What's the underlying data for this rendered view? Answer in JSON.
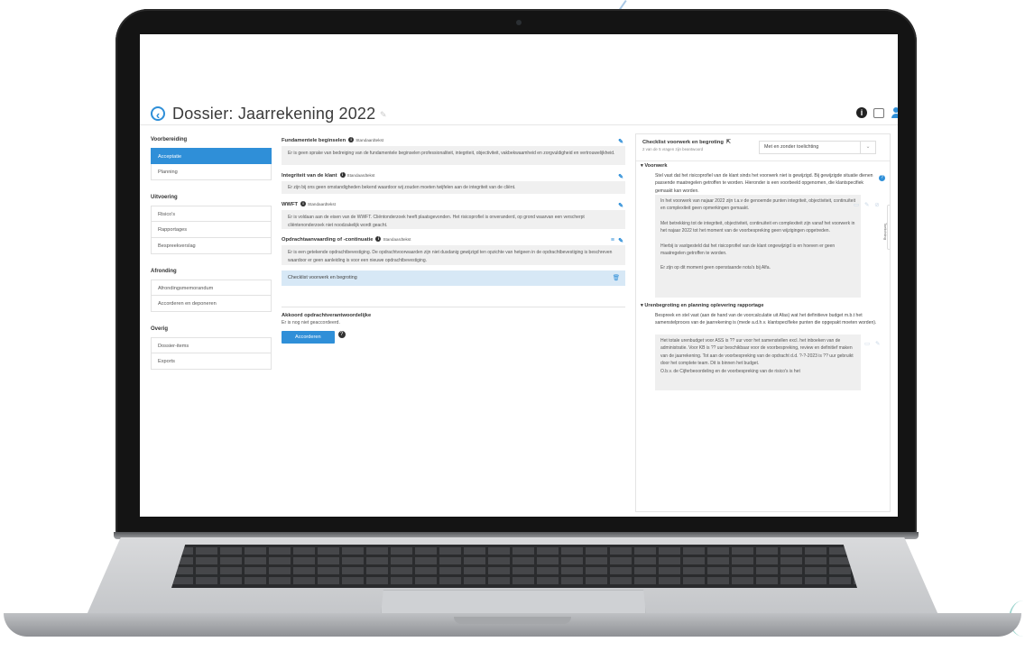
{
  "header": {
    "title": "Dossier:  Jaarrekening 2022"
  },
  "sidebar": {
    "sections": [
      {
        "title": "Voorbereiding",
        "items": [
          {
            "label": "Acceptatie",
            "active": true
          },
          {
            "label": "Planning"
          }
        ]
      },
      {
        "title": "Uitvoering",
        "items": [
          {
            "label": "Risico's"
          },
          {
            "label": "Rapportages"
          },
          {
            "label": "Bespreekverslag"
          }
        ]
      },
      {
        "title": "Afronding",
        "items": [
          {
            "label": "Afrondingsmemorandum"
          },
          {
            "label": "Accorderen en deponeren"
          }
        ]
      },
      {
        "title": "Overig",
        "items": [
          {
            "label": "Dossier-items"
          },
          {
            "label": "Exports"
          }
        ]
      }
    ]
  },
  "middle": {
    "standard_label": "Standaardtekst",
    "blocks": [
      {
        "title": "Fundamentele beginselen",
        "text": "Er is geen sprake van bedreiging van de fundamentele beginselen professionaliteit, integriteit, objectiviteit, vakbekwaamheid en zorgvuldigheid en vertrouwelijkheid."
      },
      {
        "title": "Integriteit van de klant",
        "text": "Er zijn bij ons geen omstandigheden bekend waardoor wij zouden moeten twijfelen aan de integriteit van de cliënt."
      },
      {
        "title": "WWFT",
        "text": "Er is voldaan aan de eisen van de WWFT. Cliëntonderzoek heeft plaatsgevonden. Het risicoprofiel is onveranderd, op grond waarvan een verscherpt cliëntenonderzoek niet noodzakelijk wordt geacht."
      },
      {
        "title": "Opdrachtaanvaarding of -continuatie",
        "text": "Er is een getekende opdrachtbevestiging. De opdrachtvoorwaarden zijn niet dusdanig gewijzigd ten opzichte van hetgeen in de opdrachtbevestiging is beschreven waardoor er geen aanleiding is voor een nieuwe opdrachtbevestiging."
      }
    ],
    "checklist_row": "Checklist voorwerk en begroting",
    "approval": {
      "title": "Akkoord opdrachtverantwoordelijke",
      "status": "Er is nog niet geaccordeerd.",
      "button": "Accorderen"
    }
  },
  "right": {
    "title": "Checklist voorwerk en begroting",
    "subtitle": "2 van de 5 vragen zijn beantwoord",
    "select_value": "Met en zonder toelichting",
    "tab_label": "Toelichting",
    "sections": [
      {
        "title": "▾ Voorwerk"
      },
      {
        "title": "▾ Urenbegroting en planning oplevering rapportage"
      }
    ],
    "q1": "Stel vast dat het risicoprofiel van de klant sinds het voorwerk niet is gewijzigd. Bij gewijzigde situatie dienen passende maatregelen getroffen te worden. Hieronder is een voorbeeld opgenomen, die klantspecifiek gemaakt kan worden.",
    "a1": [
      "In het voorwerk van najaar 2022 zijn t.a.v de genoemde punten integriteit, objectiviteit, continuïteit en complexiteit geen opmerkingen gemaakt.",
      "Met betrekking tot de integriteit, objectiviteit, continuïteit en complexiteit zijn vanaf het voorwerk in het najaar 2022 tot het moment van de voorbespreking geen wijzigingen opgetreden.",
      "Hierbij is vastgesteld dat het risicoprofiel van de klant ongewijzigd is en hoeven er geen maatregelen getroffen te worden.",
      "Er zijn op dit moment geen openstaande nota's bij Alfa."
    ],
    "q2": "Bespreek en stel vast (aan de hand van de voorcalculatie uit Afas) wat het definitieve budget m.b.t het samenstelproces van de jaarrekening is (mede a.d.h.v. klantspecifieke punten die opgepakt moeten worden).",
    "a2": "Het totale urenbudget voor ASS is ?? uur voor het samenstellen excl. het inboeken van de administratie. Voor KB is ?? uur beschikbaar voor de voorbespreking, review en definitief maken van de jaarrekening. Tot aan de voorbespreking van de opdracht d.d. ?-?-2023 is ?? uur gebruikt door het complete team. Dit is binnen het budget.",
    "a2_cut": "O.b.v. de Cijferbeoordeling en de voorbespreking van de risico's is het"
  }
}
